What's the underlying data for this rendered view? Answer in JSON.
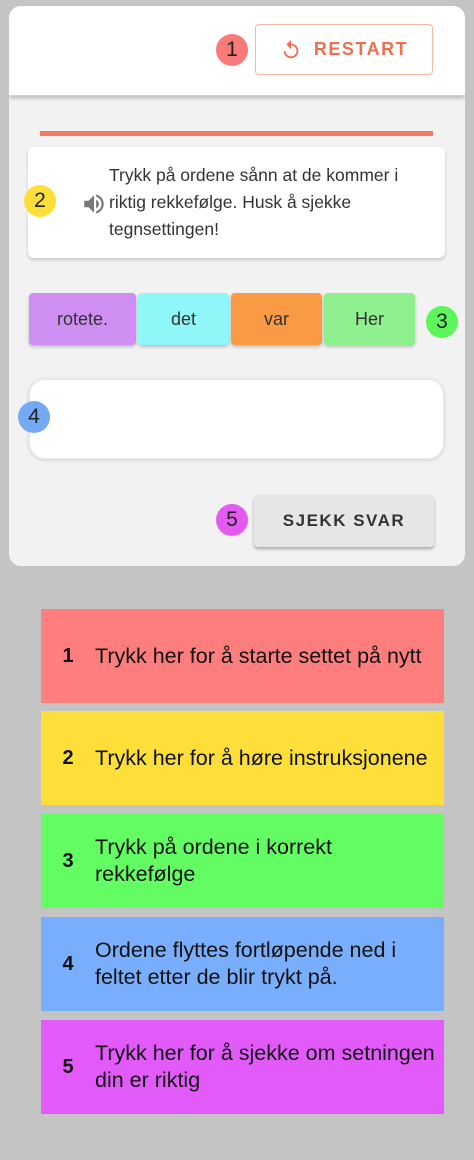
{
  "header": {
    "restart_label": "RESTART"
  },
  "instructions": {
    "text": "Trykk på ordene sånn at de kommer i riktig rekkefølge. Husk å sjekke tegnsettingen!"
  },
  "words": [
    {
      "label": "rotete.",
      "color": "#cf8ff2"
    },
    {
      "label": "det",
      "color": "#8ff7f7"
    },
    {
      "label": "var",
      "color": "#fa9a45"
    },
    {
      "label": "Her",
      "color": "#8ef08e"
    }
  ],
  "answer_field": {
    "value": ""
  },
  "check_button": {
    "label": "SJEKK SVAR"
  },
  "badges": [
    {
      "number": "1",
      "color": "#fa7a7a"
    },
    {
      "number": "2",
      "color": "#fddf3a"
    },
    {
      "number": "3",
      "color": "#5cf55c"
    },
    {
      "number": "4",
      "color": "#74a9f5"
    },
    {
      "number": "5",
      "color": "#e25af0"
    }
  ],
  "legend": [
    {
      "number": "1",
      "text": "Trykk her for å starte settet på nytt",
      "color": "#fe7e7e"
    },
    {
      "number": "2",
      "text": "Trykk her for å høre instruksjonene",
      "color": "#fedf3a"
    },
    {
      "number": "3",
      "text": "Trykk på ordene i korrekt rekkefølge",
      "color": "#63fd63"
    },
    {
      "number": "4",
      "text": "Ordene flyttes fortløpende ned i feltet etter de blir trykt på.",
      "color": "#78aefc"
    },
    {
      "number": "5",
      "text": "Trykk her for å sjekke om setningen din er riktig",
      "color": "#e35afb"
    }
  ]
}
